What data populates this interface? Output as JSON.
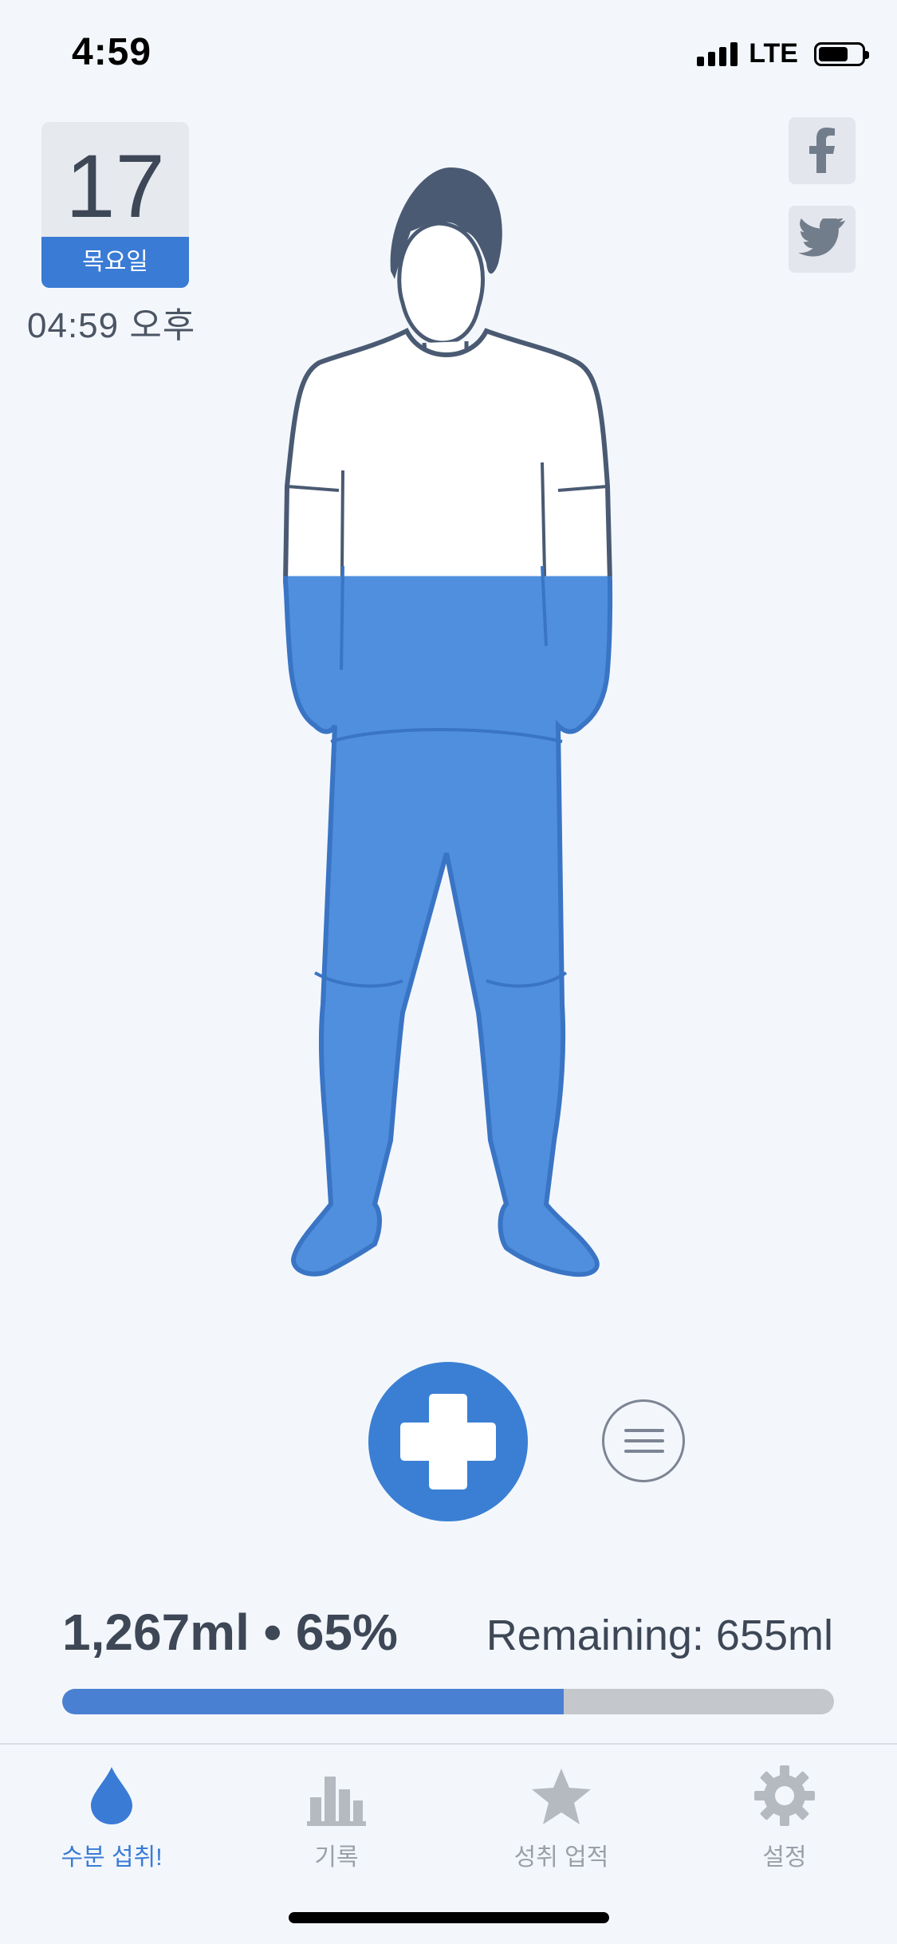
{
  "status_bar": {
    "time": "4:59",
    "network": "LTE",
    "battery_level": 0.7
  },
  "date_card": {
    "day": "17",
    "weekday": "목요일",
    "time": "04:59 오후"
  },
  "social": {
    "facebook": "facebook-icon",
    "twitter": "twitter-icon"
  },
  "figure": {
    "fill_fraction": 0.65,
    "fill_color": "#4f8fde",
    "outline_color": "#4a5a72"
  },
  "stats": {
    "intake": "1,267ml • 65%",
    "remaining": "Remaining: 655ml",
    "progress": 0.65
  },
  "tabs": [
    {
      "label": "수분 섭취!",
      "icon": "water-drop-icon",
      "active": true
    },
    {
      "label": "기록",
      "icon": "bar-chart-icon",
      "active": false
    },
    {
      "label": "성취 업적",
      "icon": "star-icon",
      "active": false
    },
    {
      "label": "설정",
      "icon": "gear-icon",
      "active": false
    }
  ],
  "colors": {
    "accent": "#3a7bd5",
    "background": "#f3f7fc",
    "inactive": "#9aa0a8"
  }
}
